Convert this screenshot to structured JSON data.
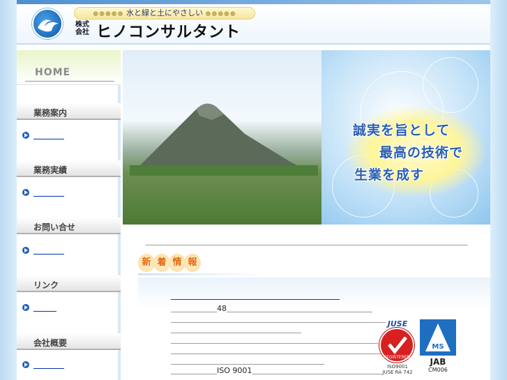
{
  "header": {
    "tagline_dots_left": "●●●●●",
    "tagline": "水と緑と土にやさしい",
    "tagline_dots_right": "●●●●●",
    "company_prefix_1": "株式",
    "company_prefix_2": "会社",
    "company_name": "ヒノコンサルタント"
  },
  "sidebar": {
    "home_label": "HOME",
    "sections": [
      {
        "heading": "業務案内",
        "link": "＿＿＿＿"
      },
      {
        "heading": "業務実績",
        "link": "＿＿＿＿"
      },
      {
        "heading": "お問い合せ",
        "link": "＿＿＿＿"
      },
      {
        "heading": "リンク",
        "link": "＿＿＿"
      },
      {
        "heading": "会社概要",
        "link": "＿＿＿＿"
      }
    ]
  },
  "hero": {
    "slogan_line1": "誠実を旨として",
    "slogan_line2": "最高の技術で",
    "slogan_line3": "生業を成す"
  },
  "intro_text": "＿＿＿＿＿＿＿＿＿＿＿＿＿＿＿＿＿＿＿＿＿＿＿＿＿＿＿＿＿＿＿＿＿＿＿＿＿＿＿＿＿＿",
  "news": {
    "heading_chars": [
      "新",
      "着",
      "情",
      "報"
    ],
    "title": "＿＿＿＿＿＿＿＿＿＿＿＿＿＿＿＿＿＿＿＿＿＿",
    "lines": [
      "＿＿＿＿＿＿48＿＿＿＿＿＿＿＿＿＿＿＿＿＿＿＿＿＿＿",
      "＿＿＿＿＿＿＿＿＿＿＿＿＿＿＿＿＿＿＿＿＿＿＿＿＿＿＿＿",
      "＿＿＿＿＿＿＿＿＿＿＿＿＿＿＿＿＿",
      "＿＿＿＿＿＿＿＿＿＿＿＿＿＿＿＿＿＿＿＿＿＿＿＿＿＿＿",
      "＿＿＿＿＿＿＿＿＿＿＿＿＿＿＿＿＿＿＿＿＿＿＿＿＿＿＿＿",
      "＿＿＿＿＿＿＿＿＿＿＿＿＿＿＿＿＿＿＿＿",
      "＿＿＿＿＿＿ISO 9001＿＿＿＿＿＿＿＿＿＿＿＿＿＿＿＿＿",
      "＿＿＿＿＿＿＿＿＿＿＿＿＿＿＿＿＿＿＿＿＿＿＿＿＿＿＿"
    ]
  },
  "badges": {
    "cert_top": "JUSE",
    "cert_center": "REGISTERED",
    "cert_bottom_1": "ISO9001",
    "cert_bottom_2": "JUSE RA 742",
    "jab_top": "MS",
    "jab_label": "JAB",
    "jab_sub": "CM006"
  },
  "colors": {
    "link": "#0033aa",
    "accent_blue": "#1f5fb8",
    "news_orange": "#e06a10",
    "cert_red": "#d82020"
  }
}
